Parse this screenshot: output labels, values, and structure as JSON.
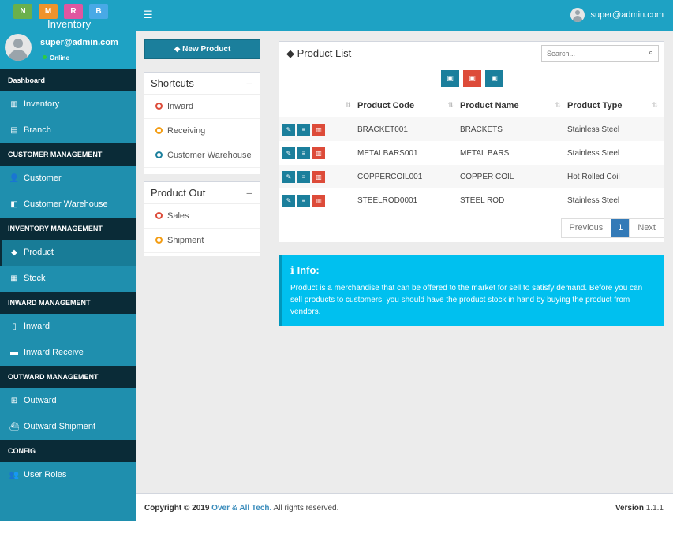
{
  "brand": {
    "logo_letters": [
      "N",
      "M",
      "R",
      "B"
    ],
    "name": "Inventory"
  },
  "user": {
    "email": "super@admin.com",
    "status": "Online"
  },
  "sidebar": {
    "sections": [
      {
        "header": "Dashboard",
        "items": [
          {
            "label": "Inventory",
            "icon": "bar-chart-icon"
          },
          {
            "label": "Branch",
            "icon": "building-icon"
          }
        ]
      },
      {
        "header": "CUSTOMER MANAGEMENT",
        "items": [
          {
            "label": "Customer",
            "icon": "user-plus-icon"
          },
          {
            "label": "Customer Warehouse",
            "icon": "warehouse-icon"
          }
        ]
      },
      {
        "header": "INVENTORY MANAGEMENT",
        "items": [
          {
            "label": "Product",
            "icon": "tag-icon",
            "active": true
          },
          {
            "label": "Stock",
            "icon": "cubes-icon"
          }
        ]
      },
      {
        "header": "INWARD MANAGEMENT",
        "items": [
          {
            "label": "Inward",
            "icon": "file-icon"
          },
          {
            "label": "Inward Receive",
            "icon": "truck-icon"
          }
        ]
      },
      {
        "header": "OUTWARD MANAGEMENT",
        "items": [
          {
            "label": "Outward",
            "icon": "cart-icon"
          },
          {
            "label": "Outward Shipment",
            "icon": "ship-icon"
          }
        ]
      },
      {
        "header": "CONFIG",
        "items": [
          {
            "label": "User Roles",
            "icon": "users-icon"
          }
        ]
      }
    ]
  },
  "topbar": {
    "user_email": "super@admin.com"
  },
  "actions": {
    "new_product": "New Product"
  },
  "shortcuts": {
    "title": "Shortcuts",
    "items": [
      {
        "label": "Inward",
        "color": "#dd4b39"
      },
      {
        "label": "Receiving",
        "color": "#f39c12"
      },
      {
        "label": "Customer Warehouse",
        "color": "#1b7f9c"
      }
    ]
  },
  "product_out": {
    "title": "Product Out",
    "items": [
      {
        "label": "Sales",
        "color": "#dd4b39"
      },
      {
        "label": "Shipment",
        "color": "#f39c12"
      }
    ]
  },
  "product_list": {
    "title": "Product List",
    "search_placeholder": "Search...",
    "export_buttons": [
      "csv-export",
      "pdf-export",
      "excel-export"
    ],
    "columns": [
      "Product Code",
      "Product Name",
      "Product Type"
    ],
    "rows": [
      {
        "code": "BRACKET001",
        "name": "BRACKETS",
        "type": "Stainless Steel"
      },
      {
        "code": "METALBARS001",
        "name": "METAL BARS",
        "type": "Stainless Steel"
      },
      {
        "code": "COPPERCOIL001",
        "name": "COPPER COIL",
        "type": "Hot Rolled Coil"
      },
      {
        "code": "STEELROD0001",
        "name": "STEEL ROD",
        "type": "Stainless Steel"
      }
    ],
    "pagination": {
      "prev": "Previous",
      "current": "1",
      "next": "Next"
    }
  },
  "info": {
    "title": "Info:",
    "text": "Product is a merchandise that can be offered to the market for sell to satisfy demand. Before you can sell products to customers, you should have the product stock in hand by buying the product from vendors."
  },
  "footer": {
    "copyright_prefix": "Copyright © 2019",
    "company": "Over & All Tech.",
    "rights": "All rights reserved.",
    "version_label": "Version",
    "version": "1.1.1"
  },
  "colors": {
    "sidebar_bg": "#1f8fae",
    "topbar_bg": "#1ea2c4",
    "section_header_bg": "#0a2b37",
    "primary_button": "#1b7f9c",
    "danger": "#dd4b39",
    "info_bg": "#00c0ef",
    "pagination_active": "#337ab7"
  }
}
